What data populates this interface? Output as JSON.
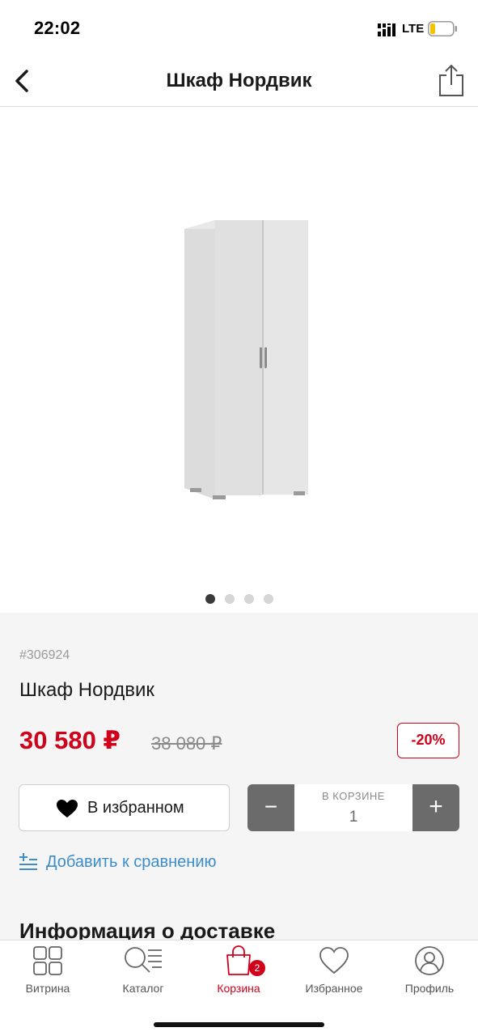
{
  "status_bar": {
    "time": "22:02",
    "network": "LTE"
  },
  "nav": {
    "title": "Шкаф Нордвик",
    "back_icon": "chevron-left-icon",
    "share_icon": "share-icon"
  },
  "gallery": {
    "image": "white-two-door-wardrobe",
    "pages": 4,
    "active_page": 1
  },
  "product": {
    "sku": "#306924",
    "name": "Шкаф Нордвик",
    "price": "30 580 ₽",
    "old_price": "38 080 ₽",
    "discount": "-20%"
  },
  "actions": {
    "favorite_label": "В избранном",
    "cart_caption": "В КОРЗИНЕ",
    "cart_quantity": "1",
    "minus_label": "−",
    "plus_label": "+",
    "compare_label": "Добавить к сравнению"
  },
  "delivery": {
    "heading": "Информация о доставке"
  },
  "tabs": [
    {
      "label": "Витрина",
      "icon": "grid-icon"
    },
    {
      "label": "Каталог",
      "icon": "catalog-search-icon"
    },
    {
      "label": "Корзина",
      "icon": "shopping-bag-icon",
      "badge": "2",
      "active": true
    },
    {
      "label": "Избранное",
      "icon": "heart-icon"
    },
    {
      "label": "Профиль",
      "icon": "profile-icon"
    }
  ],
  "colors": {
    "accent": "#d0021b",
    "link": "#3c8dc9",
    "stepper": "#6b6b6b"
  }
}
